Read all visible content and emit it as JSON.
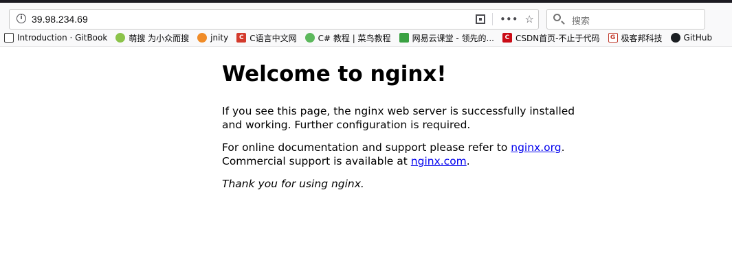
{
  "browser": {
    "url": "39.98.234.69",
    "search_placeholder": "搜索",
    "icons": [
      "info-icon",
      "qr-code-icon",
      "more-actions-icon",
      "bookmark-star-icon",
      "search-icon"
    ]
  },
  "bookmarks": [
    {
      "label": "Introduction · GitBook",
      "icon": "book-icon",
      "color": "#333333",
      "glyph": ""
    },
    {
      "label": "萌搜 为小众而搜",
      "icon": "mengsou-icon",
      "color": "#8bc34a",
      "glyph": ""
    },
    {
      "label": "jnity",
      "icon": "jnity-icon",
      "color": "#f08c28",
      "glyph": ""
    },
    {
      "label": "C语言中文网",
      "icon": "c-language-icon",
      "color": "#d33a2c",
      "glyph": "C"
    },
    {
      "label": "C# 教程 | 菜鸟教程",
      "icon": "runoob-icon",
      "color": "#5cb85c",
      "glyph": ""
    },
    {
      "label": "网易云课堂 - 领先的...",
      "icon": "netease-study-icon",
      "color": "#3aa142",
      "glyph": ""
    },
    {
      "label": "CSDN首页-不止于代码",
      "icon": "csdn-icon",
      "color": "#ca0c16",
      "glyph": "C"
    },
    {
      "label": "极客邦科技",
      "icon": "geekbang-icon",
      "color": "#c0392b",
      "glyph": "G"
    },
    {
      "label": "GitHub",
      "icon": "github-icon",
      "color": "#1b1f23",
      "glyph": ""
    }
  ],
  "page": {
    "heading": "Welcome to nginx!",
    "para1": "If you see this page, the nginx web server is successfully installed and working. Further configuration is required.",
    "para2_prefix": "For online documentation and support please refer to ",
    "link_org": "nginx.org",
    "para2_mid": ". Commercial support is available at ",
    "link_com": "nginx.com",
    "para2_suffix": ".",
    "para3": "Thank you for using nginx."
  }
}
